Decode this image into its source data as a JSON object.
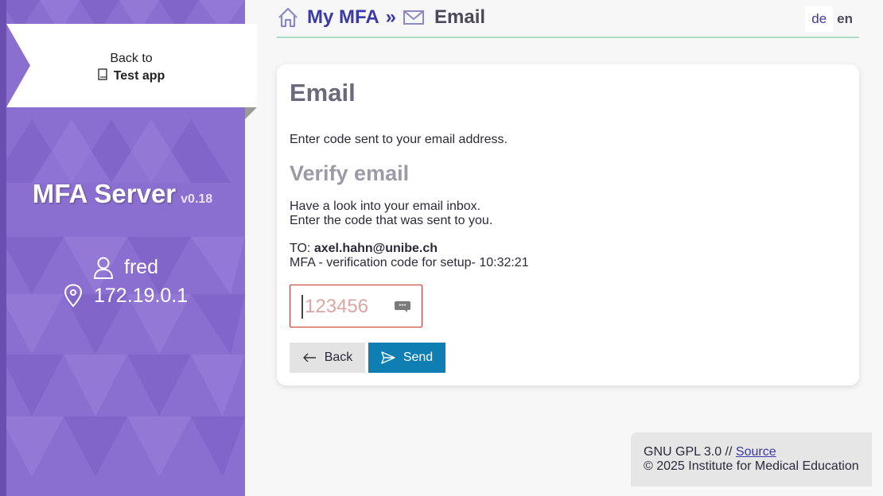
{
  "sidebar": {
    "back_label": "Back to",
    "back_app": "Test app",
    "app_name": "MFA Server",
    "version": "v0.18",
    "user": "fred",
    "ip": "172.19.0.1"
  },
  "header": {
    "home_label": "My MFA",
    "separator": "»",
    "current_label": "Email",
    "lang_de": "de",
    "lang_en": "en"
  },
  "card": {
    "title": "Email",
    "intro": "Enter code sent to your email address.",
    "subtitle": "Verify email",
    "hint_line1": "Have a look into your email inbox.",
    "hint_line2": "Enter the code that was sent to you.",
    "to_prefix": "TO:",
    "to_address": "axel.hahn@unibe.ch",
    "subject": "MFA - verification code for setup- 10:32:21",
    "code_placeholder": "123456",
    "code_value": "",
    "back_button": "Back",
    "send_button": "Send"
  },
  "footer": {
    "license": "GNU GPL 3.0 //",
    "source_link": "Source",
    "copyright": "© 2025 Institute for Medical Education"
  },
  "colors": {
    "sidebar": "#8b6fd0",
    "accent": "#3b3aa8",
    "send_button": "#0f7fb3",
    "error": "#c9302c",
    "header_line": "#a6dcc6"
  }
}
